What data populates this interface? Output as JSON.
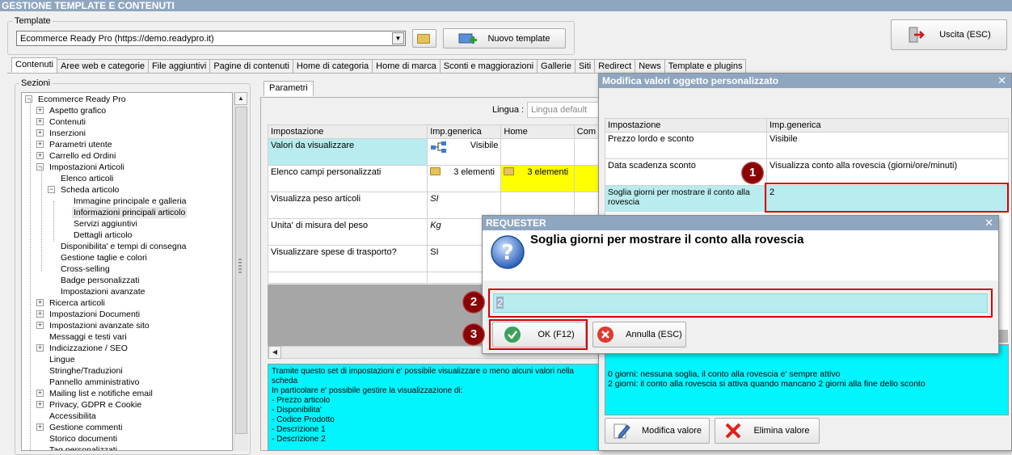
{
  "window": {
    "title": "GESTIONE TEMPLATE E CONTENUTI"
  },
  "template": {
    "legend": "Template",
    "selected": "Ecommerce Ready Pro (https://demo.readypro.it)",
    "new_label": "Nuovo template",
    "exit_label": "Uscita (ESC)"
  },
  "tabs": [
    "Contenuti",
    "Aree web e categorie",
    "File aggiuntivi",
    "Pagine di contenuti",
    "Home di categoria",
    "Home di marca",
    "Sconti e maggiorazioni",
    "Gallerie",
    "Siti",
    "Redirect",
    "News",
    "Template e plugins"
  ],
  "sections": {
    "legend": "Sezioni",
    "tree": [
      {
        "label": "Ecommerce Ready Pro",
        "level": 0,
        "exp": "-"
      },
      {
        "label": "Aspetto grafico",
        "level": 1,
        "exp": "+"
      },
      {
        "label": "Contenuti",
        "level": 1,
        "exp": "+"
      },
      {
        "label": "Inserzioni",
        "level": 1,
        "exp": "+"
      },
      {
        "label": "Parametri utente",
        "level": 1,
        "exp": "+"
      },
      {
        "label": "Carrello ed Ordini",
        "level": 1,
        "exp": "+"
      },
      {
        "label": "Impostazioni Articoli",
        "level": 1,
        "exp": "-"
      },
      {
        "label": "Elenco articoli",
        "level": 2,
        "exp": ""
      },
      {
        "label": "Scheda articolo",
        "level": 2,
        "exp": "-"
      },
      {
        "label": "Immagine principale e galleria",
        "level": 3,
        "exp": ""
      },
      {
        "label": "Informazioni principali articolo",
        "level": 3,
        "exp": "",
        "selected": true
      },
      {
        "label": "Servizi aggiuntivi",
        "level": 3,
        "exp": ""
      },
      {
        "label": "Dettagli articolo",
        "level": 3,
        "exp": ""
      },
      {
        "label": "Disponibilita' e tempi di consegna",
        "level": 2,
        "exp": ""
      },
      {
        "label": "Gestione taglie e colori",
        "level": 2,
        "exp": ""
      },
      {
        "label": "Cross-selling",
        "level": 2,
        "exp": ""
      },
      {
        "label": "Badge personalizzati",
        "level": 2,
        "exp": ""
      },
      {
        "label": "Impostazioni avanzate",
        "level": 2,
        "exp": ""
      },
      {
        "label": "Ricerca articoli",
        "level": 1,
        "exp": "+"
      },
      {
        "label": "Impostazioni Documenti",
        "level": 1,
        "exp": "+"
      },
      {
        "label": "Impostazioni avanzate sito",
        "level": 1,
        "exp": "+"
      },
      {
        "label": "Messaggi e testi vari",
        "level": 1,
        "exp": ""
      },
      {
        "label": "Indicizzazione / SEO",
        "level": 1,
        "exp": "+"
      },
      {
        "label": "Lingue",
        "level": 1,
        "exp": ""
      },
      {
        "label": "Stringhe/Traduzioni",
        "level": 1,
        "exp": ""
      },
      {
        "label": "Pannello amministrativo",
        "level": 1,
        "exp": ""
      },
      {
        "label": "Mailing list e notifiche email",
        "level": 1,
        "exp": "+"
      },
      {
        "label": "Privacy, GDPR e Cookie",
        "level": 1,
        "exp": "+"
      },
      {
        "label": "Accessibilita",
        "level": 1,
        "exp": ""
      },
      {
        "label": "Gestione commenti",
        "level": 1,
        "exp": "+"
      },
      {
        "label": "Storico documenti",
        "level": 1,
        "exp": ""
      },
      {
        "label": "Tag personalizzati",
        "level": 1,
        "exp": ""
      }
    ]
  },
  "params": {
    "tab": "Parametri",
    "lang_label": "Lingua :",
    "lang_placeholder": "Lingua default",
    "headers": [
      "Impostazione",
      "Imp.generica",
      "Home",
      "Com"
    ],
    "rows": [
      {
        "name": "Valori da visualizzare",
        "generic": "Visibile"
      },
      {
        "name": "Elenco campi personalizzati",
        "generic": "3 elementi",
        "home": "3 elementi"
      },
      {
        "name": "Visualizza peso articoli",
        "generic": "SI"
      },
      {
        "name": "Unita' di misura del peso",
        "generic": "Kg"
      },
      {
        "name": "Visualizzare spese di trasporto?",
        "generic": "SI"
      }
    ],
    "description": [
      "Tramite questo set di impostazioni e' possibile visualizzare o meno alcuni valori nella scheda",
      "In particolare e' possibile gestire la visualizzazione di:",
      "- Prezzo articolo",
      "- Disponibilita'",
      "- Codice Prodotto",
      "- Descrizione 1",
      "- Descrizione 2"
    ]
  },
  "modifica": {
    "title": "Modifica valori oggetto personalizzato",
    "headers": [
      "Impostazione",
      "Imp.generica"
    ],
    "rows": [
      {
        "name": "Prezzo lordo e sconto",
        "value": "Visibile"
      },
      {
        "name": "Data scadenza sconto",
        "value": "Visualizza conto alla rovescia (giorni/ore/minuti)"
      },
      {
        "name": "Soglia giorni per mostrare il conto alla rovescia",
        "value": "2"
      }
    ],
    "info": [
      "0 giorni: nessuna soglia, il conto alla rovescia e' sempre attivo",
      "2 giorni: il conto alla rovescia si attiva quando mancano 2 giorni alla fine dello sconto"
    ],
    "edit_label": "Modifica valore",
    "delete_label": "Elimina valore"
  },
  "requester": {
    "title": "REQUESTER",
    "question": "Soglia giorni per mostrare il conto alla rovescia",
    "value": "2",
    "ok_label": "OK (F12)",
    "cancel_label": "Annulla (ESC)"
  },
  "markers": [
    "1",
    "2",
    "3"
  ]
}
